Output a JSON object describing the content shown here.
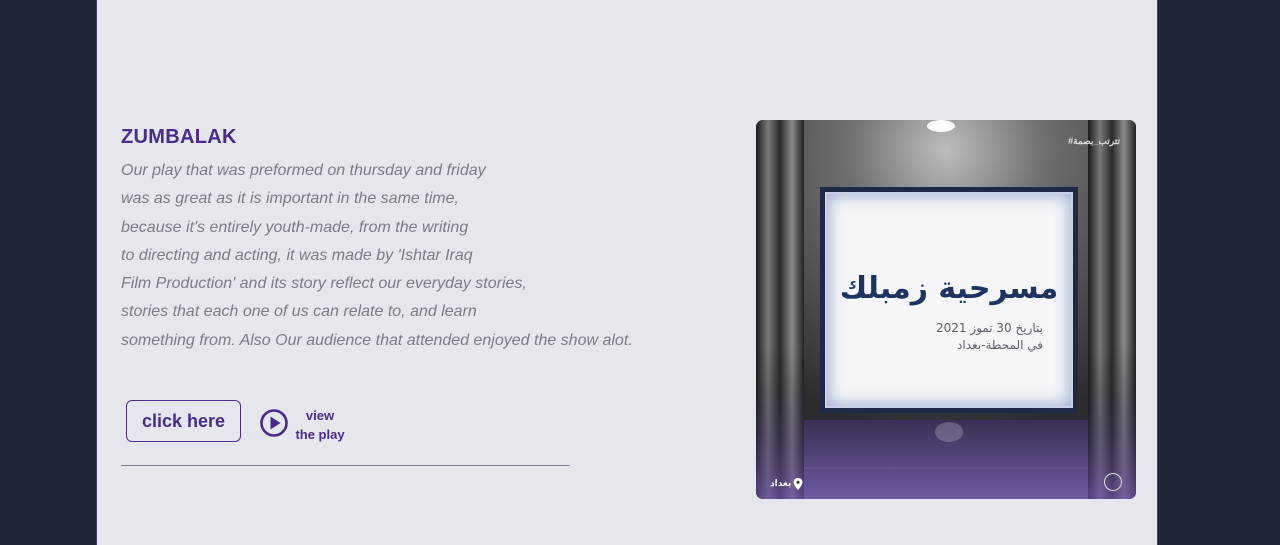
{
  "post": {
    "title": "ZUMBALAK",
    "description_lines": [
      "Our play that was preformed on thursday and friday",
      "was as great as it is important in the same time,",
      "because it's entirely youth-made, from the writing",
      "to directing and acting, it was made by 'Ishtar Iraq",
      "Film Production' and its story reflect our everyday stories,",
      "stories that each one of us can relate to, and learn",
      "something from. Also Our audience that attended enjoyed the show alot."
    ],
    "button_label": "click here",
    "play_label_line1": "view",
    "play_label_line2": "the play"
  },
  "poster": {
    "hashtag": "#تترتب_بصمة",
    "title_ar": "مسرحية زمبلك",
    "date_ar": "بتاريخ 30 تموز 2021",
    "place_ar": "في المحطة-بغداد",
    "location_ar": "بغداد"
  },
  "colors": {
    "background": "#1f2636",
    "panel": "#e6e7ec",
    "accent": "#4b2a8e",
    "text_muted": "#7a7c86"
  },
  "icons": {
    "play": "play-circle-icon",
    "location": "location-pin-icon"
  }
}
